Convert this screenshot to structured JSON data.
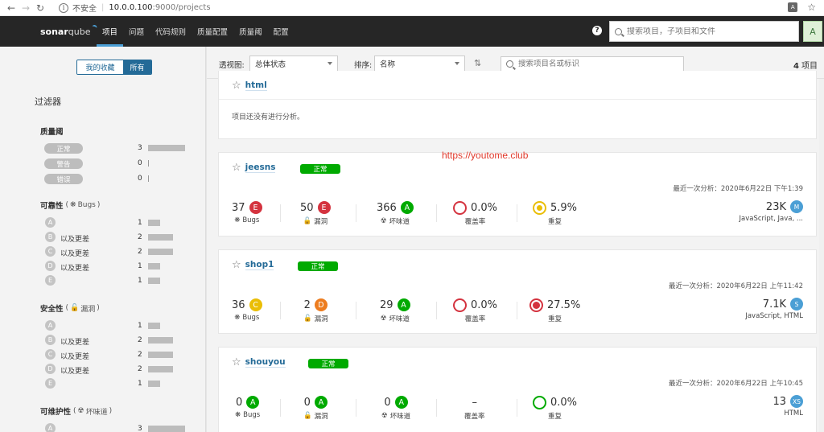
{
  "browser": {
    "insecure_label": "不安全",
    "separator": "|",
    "url_host": "10.0.0.100",
    "url_path": ":9000/projects"
  },
  "nav": {
    "logo_bold": "sonar",
    "logo_light": "qube",
    "items": [
      "项目",
      "问题",
      "代码规则",
      "质量配置",
      "质量阈",
      "配置"
    ],
    "help": "?",
    "search_placeholder": "搜索项目，子项目和文件",
    "avatar": "A"
  },
  "sidebar": {
    "fav_label": "我的收藏",
    "all_label": "所有",
    "filters_title": "过滤器",
    "quality_gate": {
      "title": "质量阈",
      "rows": [
        {
          "label": "正常",
          "count": "3"
        },
        {
          "label": "警告",
          "count": "0"
        },
        {
          "label": "错误",
          "count": "0"
        }
      ]
    },
    "reliability": {
      "title": "可靠性",
      "sub_open": "(",
      "sub": "Bugs",
      "sub_close": ")",
      "rows": [
        {
          "rating": "A",
          "suffix": "",
          "count": "1"
        },
        {
          "rating": "B",
          "suffix": "以及更差",
          "count": "2"
        },
        {
          "rating": "C",
          "suffix": "以及更差",
          "count": "2"
        },
        {
          "rating": "D",
          "suffix": "以及更差",
          "count": "1"
        },
        {
          "rating": "E",
          "suffix": "",
          "count": "1"
        }
      ]
    },
    "security": {
      "title": "安全性",
      "sub_open": "(",
      "sub": "漏洞",
      "sub_close": ")",
      "rows": [
        {
          "rating": "A",
          "suffix": "",
          "count": "1"
        },
        {
          "rating": "B",
          "suffix": "以及更差",
          "count": "2"
        },
        {
          "rating": "C",
          "suffix": "以及更差",
          "count": "2"
        },
        {
          "rating": "D",
          "suffix": "以及更差",
          "count": "2"
        },
        {
          "rating": "E",
          "suffix": "",
          "count": "1"
        }
      ]
    },
    "maintainability": {
      "title": "可维护性",
      "sub_open": "(",
      "sub": "坏味道",
      "sub_close": ")",
      "rows": [
        {
          "rating": "A",
          "suffix": "",
          "count": "3"
        }
      ]
    }
  },
  "toolbar": {
    "view_label": "透视图:",
    "view_value": "总体状态",
    "sort_label": "排序:",
    "sort_value": "名称",
    "search_placeholder": "搜索项目名或标识",
    "count": "4",
    "count_unit": "项目"
  },
  "watermark": "https://youtome.club",
  "projects": [
    {
      "name": "html",
      "message": "项目还没有进行分析。"
    },
    {
      "name": "jeesns",
      "gate": "正常",
      "last_analysis": "最近一次分析：2020年6月22日 下午1:39",
      "bugs": "37",
      "bugs_rating": "E",
      "bugs_label": "Bugs",
      "vulns": "50",
      "vulns_rating": "E",
      "vulns_label": "漏洞",
      "smells": "366",
      "smells_rating": "A",
      "smells_label": "坏味道",
      "coverage": "0.0%",
      "coverage_label": "覆盖率",
      "duplication": "5.9%",
      "duplication_label": "重复",
      "size": "23K",
      "size_rating": "M",
      "languages": "JavaScript, Java, ..."
    },
    {
      "name": "shop1",
      "gate": "正常",
      "last_analysis": "最近一次分析：2020年6月22日 上午11:42",
      "bugs": "36",
      "bugs_rating": "C",
      "bugs_label": "Bugs",
      "vulns": "2",
      "vulns_rating": "D",
      "vulns_label": "漏洞",
      "smells": "29",
      "smells_rating": "A",
      "smells_label": "坏味道",
      "coverage": "0.0%",
      "coverage_label": "覆盖率",
      "duplication": "27.5%",
      "duplication_label": "重复",
      "size": "7.1K",
      "size_rating": "S",
      "languages": "JavaScript, HTML"
    },
    {
      "name": "shouyou",
      "gate": "正常",
      "last_analysis": "最近一次分析：2020年6月22日 上午10:45",
      "bugs": "0",
      "bugs_rating": "A",
      "bugs_label": "Bugs",
      "vulns": "0",
      "vulns_rating": "A",
      "vulns_label": "漏洞",
      "smells": "0",
      "smells_rating": "A",
      "smells_label": "坏味道",
      "coverage": "–",
      "coverage_label": "覆盖率",
      "duplication": "0.0%",
      "duplication_label": "重复",
      "size": "13",
      "size_rating": "XS",
      "languages": "HTML"
    }
  ],
  "colors": {
    "nav_bg": "#262626",
    "accent": "#236a97",
    "rating_a": "#00aa00",
    "rating_c": "#eabe06",
    "rating_d": "#ed7d20",
    "rating_e": "#d4333f"
  }
}
